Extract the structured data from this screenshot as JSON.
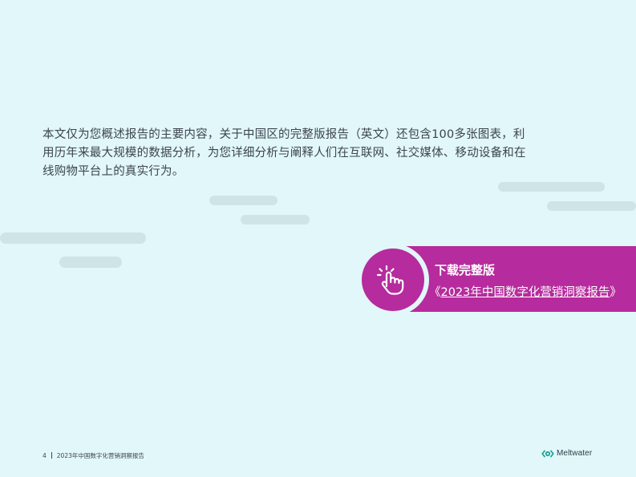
{
  "intro": {
    "text": "本文仅为您概述报告的主要内容，关于中国区的完整版报告（英文）还包含100多张图表，利用历年来最大规模的数据分析，为您详细分析与阐释人们在互联网、社交媒体、移动设备和在线购物平台上的真实行为。"
  },
  "cta": {
    "title": "下载完整版",
    "link_open": "《",
    "link_text": "2023年中国数字化营销洞察报告",
    "link_close": "》",
    "icon": "tap-hand-icon",
    "color": "#b62b9d"
  },
  "footer": {
    "page_number": "4",
    "report_title": "2023年中国数字化营销洞察报告",
    "logo_text": "Meltwater",
    "logo_color": "#1fa39a"
  },
  "colors": {
    "background": "#e1f7f9",
    "accent": "#b62b9d",
    "text": "#3d4450",
    "cloud": "#cfe4e7"
  }
}
